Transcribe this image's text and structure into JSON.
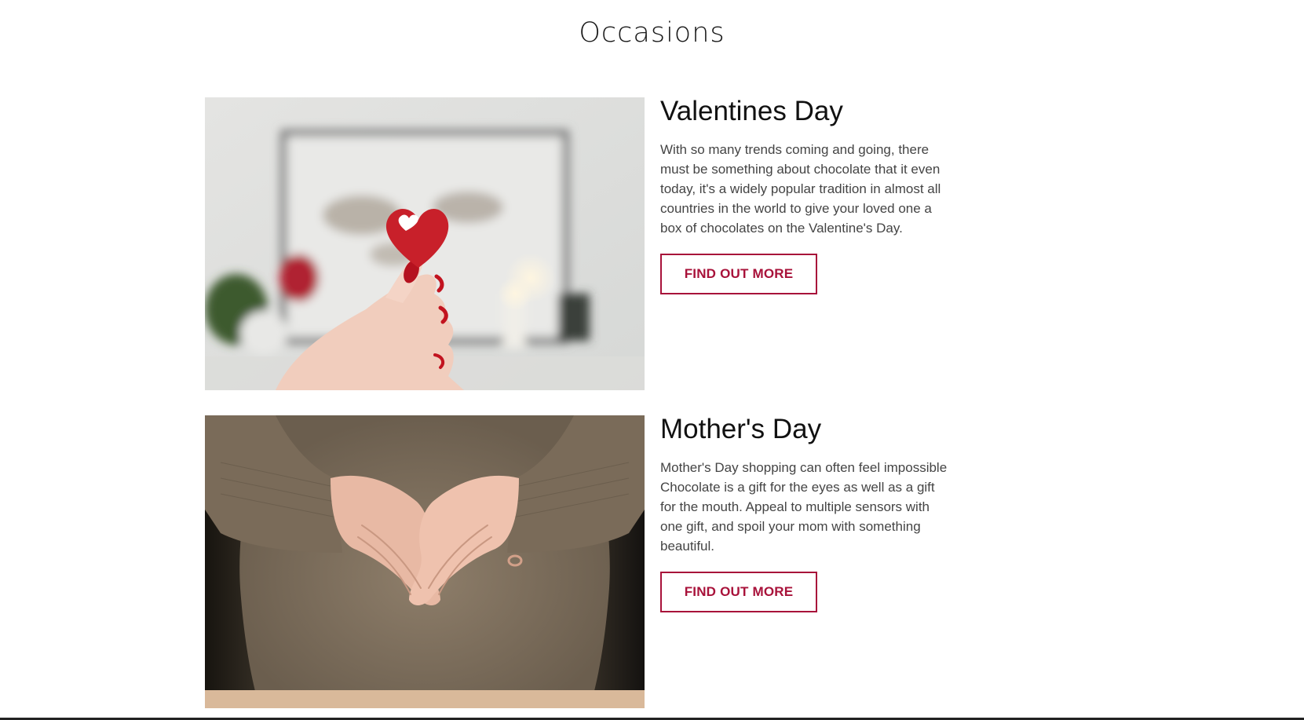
{
  "page": {
    "title": "Occasions"
  },
  "occasions": [
    {
      "heading": "Valentines Day",
      "description": "With so many trends coming and going, there must be something about chocolate that it even today, it's a widely popular tradition in almost all countries in the world to give your loved one a box of chocolates on the Valentine's Day.",
      "button_label": "FIND OUT MORE",
      "image_subject": "hand-holding-heart"
    },
    {
      "heading": "Mother's Day",
      "description": "Mother's Day shopping can often feel impossible Chocolate is a gift for the eyes as well as a gift for the mouth. Appeal to multiple sensors with one gift, and spoil your mom with something beautiful.",
      "button_label": "FIND OUT MORE",
      "image_subject": "hands-heart-on-belly"
    }
  ],
  "colors": {
    "accent": "#a8123a",
    "heading": "#111111",
    "body_text": "#444444",
    "background": "#ffffff"
  }
}
